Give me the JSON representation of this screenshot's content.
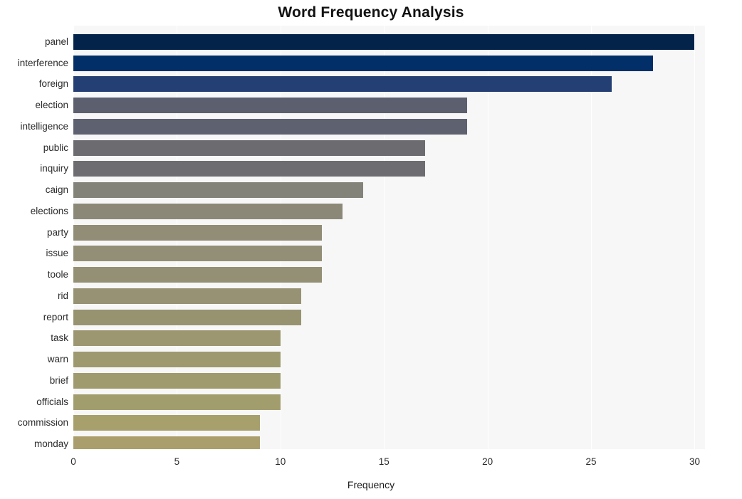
{
  "chart_data": {
    "type": "bar",
    "orientation": "horizontal",
    "title": "Word Frequency Analysis",
    "xlabel": "Frequency",
    "ylabel": "",
    "xlim": [
      0,
      30.5
    ],
    "xticks": [
      0,
      5,
      10,
      15,
      20,
      25,
      30
    ],
    "xtick_labels": [
      "0",
      "5",
      "10",
      "15",
      "20",
      "25",
      "30"
    ],
    "grid": "vertical-white-on-light-gray",
    "legend": "none",
    "categories": [
      "panel",
      "interference",
      "foreign",
      "election",
      "intelligence",
      "public",
      "inquiry",
      "caign",
      "elections",
      "party",
      "issue",
      "toole",
      "rid",
      "report",
      "task",
      "warn",
      "brief",
      "officials",
      "commission",
      "monday"
    ],
    "values": [
      30,
      28,
      26,
      19,
      19,
      17,
      17,
      14,
      13,
      12,
      12,
      12,
      11,
      11,
      10,
      10,
      10,
      10,
      9,
      9
    ],
    "bar_colors": [
      "#03234b",
      "#032f68",
      "#243f73",
      "#5b5f6e",
      "#5d6170",
      "#6b6b70",
      "#6d6d71",
      "#84837a",
      "#8b8878",
      "#918d76",
      "#938f76",
      "#949075",
      "#969273",
      "#979371",
      "#9c9770",
      "#9e996f",
      "#a09b6e",
      "#a29d6d",
      "#a79f6c",
      "#aa9e6c"
    ],
    "plot_background": "#f7f7f7",
    "gridline_color": "#ffffff",
    "page_background": "#ffffff",
    "text_color": "#222222"
  }
}
